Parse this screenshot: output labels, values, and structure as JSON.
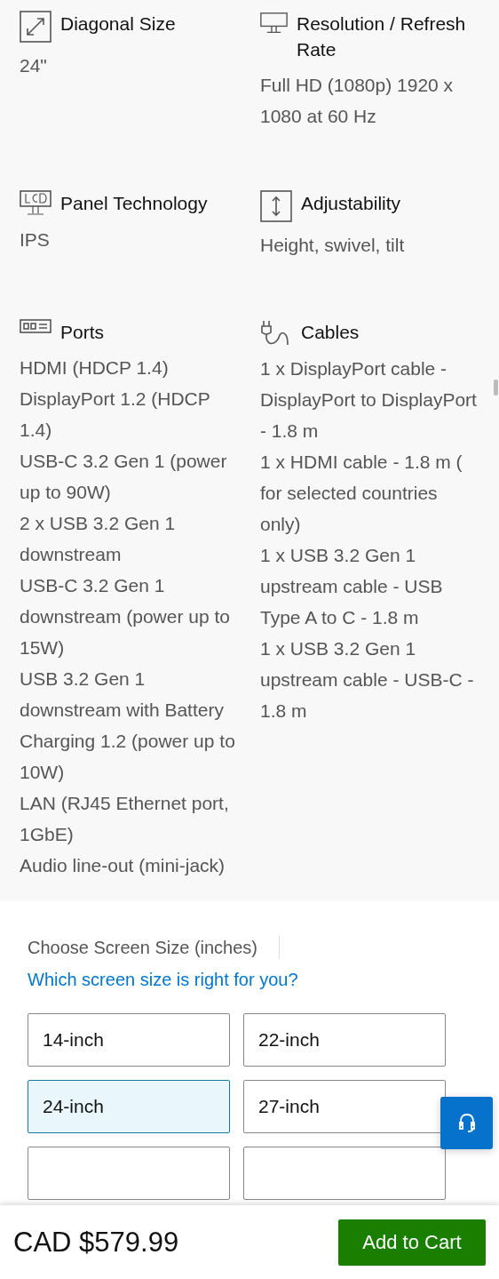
{
  "specs": [
    {
      "title": "Diagonal Size",
      "lines": [
        "24\""
      ]
    },
    {
      "title": "Resolution / Refresh Rate",
      "lines": [
        "Full HD (1080p) 1920 x 1080 at 60 Hz"
      ]
    },
    {
      "title": "Panel Technology",
      "lines": [
        "IPS"
      ]
    },
    {
      "title": "Adjustability",
      "lines": [
        "Height, swivel, tilt"
      ]
    },
    {
      "title": "Ports",
      "lines": [
        "HDMI (HDCP 1.4)",
        "DisplayPort 1.2 (HDCP 1.4)",
        "USB-C 3.2 Gen 1 (power up to 90W)",
        "2 x USB 3.2 Gen 1 downstream",
        "USB-C 3.2 Gen 1 downstream (power up to 15W)",
        "USB 3.2 Gen 1 downstream with Battery Charging 1.2 (power up to 10W)",
        "LAN (RJ45 Ethernet port, 1GbE)",
        "Audio line-out (mini-jack)"
      ]
    },
    {
      "title": "Cables",
      "lines": [
        "1 x DisplayPort cable - DisplayPort to DisplayPort - 1.8 m",
        "1 x HDMI cable - 1.8 m ( for selected countries only)",
        "1 x USB 3.2 Gen 1 upstream cable - USB Type A to C - 1.8 m",
        "1 x USB 3.2 Gen 1 upstream cable - USB-C - 1.8 m"
      ]
    }
  ],
  "size_chooser": {
    "label": "Choose Screen Size (inches)",
    "link": "Which screen size is right for you?",
    "options": [
      {
        "label": "14-inch",
        "selected": false
      },
      {
        "label": "22-inch",
        "selected": false
      },
      {
        "label": "24-inch",
        "selected": true
      },
      {
        "label": "27-inch",
        "selected": false
      }
    ]
  },
  "footer": {
    "price": "CAD $579.99",
    "button": "Add to Cart"
  }
}
